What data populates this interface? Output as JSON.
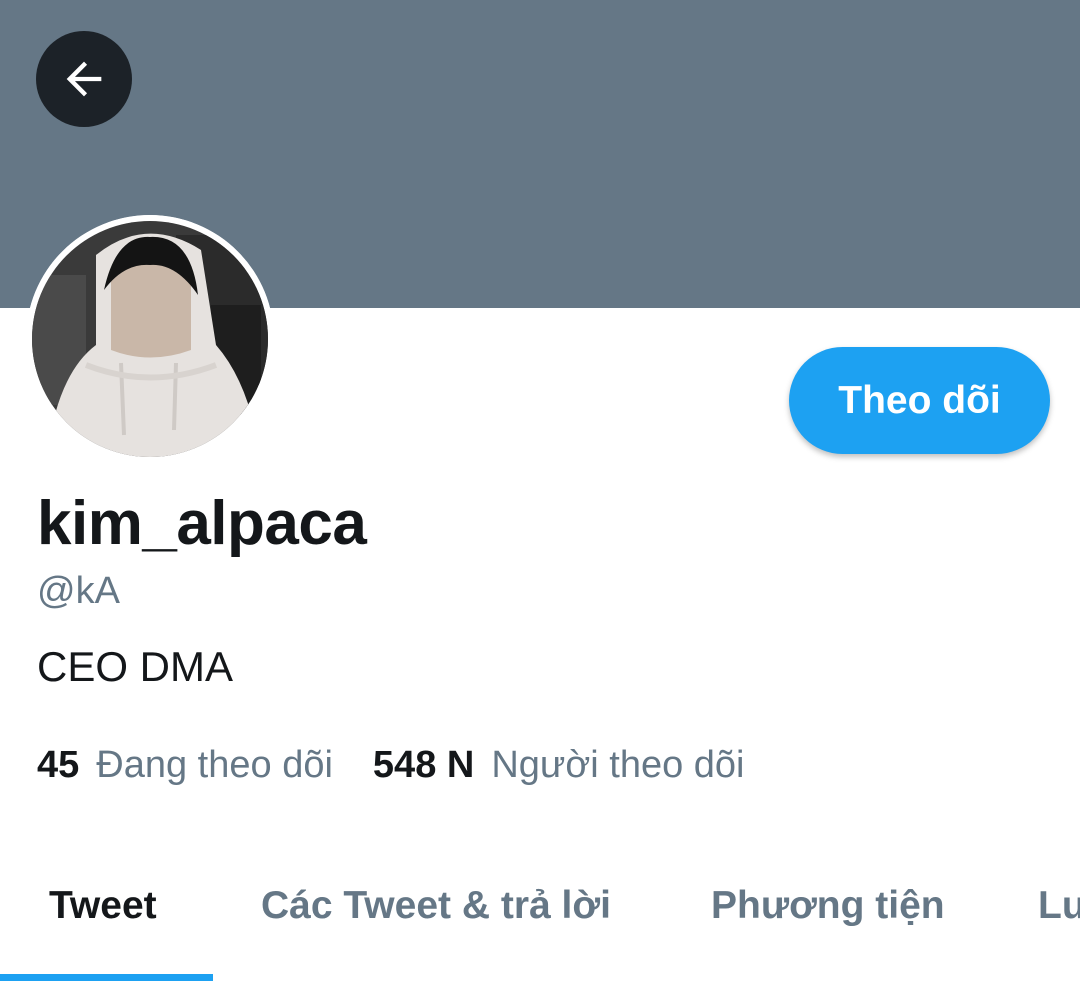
{
  "colors": {
    "banner": "#657786",
    "accent": "#1da1f2",
    "text_primary": "#14171a",
    "text_secondary": "#657786",
    "back_button_bg": "#1c2228"
  },
  "header": {
    "back_icon": "arrow-left-icon"
  },
  "profile": {
    "follow_label": "Theo dõi",
    "display_name": "kim_alpaca",
    "handle": "@kA",
    "bio": "CEO DMA",
    "following_count": "45",
    "following_label": "Đang theo dõi",
    "followers_count": "548 N",
    "followers_label": "Người theo dõi"
  },
  "tabs": [
    {
      "label": "Tweet",
      "active": true
    },
    {
      "label": "Các Tweet & trả lời",
      "active": false
    },
    {
      "label": "Phương tiện",
      "active": false
    },
    {
      "label": "Lư",
      "active": false
    }
  ]
}
